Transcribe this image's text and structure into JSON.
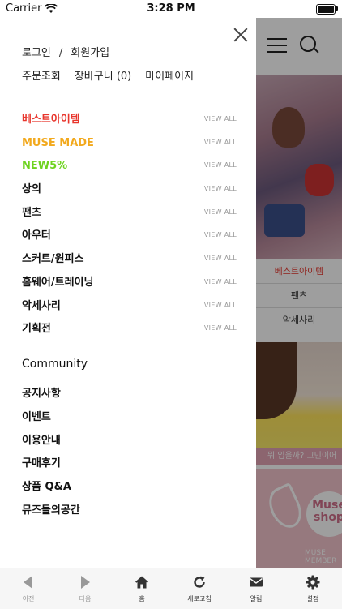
{
  "status_bar": {
    "carrier": "Carrier",
    "time": "3:28 PM"
  },
  "drawer": {
    "account": {
      "login": "로그인",
      "separator": "/",
      "signup": "회원가입"
    },
    "quick_links": {
      "orders": "주문조회",
      "cart": "장바구니 (0)",
      "mypage": "마이페이지"
    },
    "categories": [
      {
        "label": "베스트아이템",
        "color": "#e8352c",
        "view_all": "VIEW ALL"
      },
      {
        "label": "MUSE MADE",
        "color": "#f2a91d",
        "view_all": "VIEW ALL"
      },
      {
        "label": "NEW5%",
        "color": "#6ed31f",
        "view_all": "VIEW ALL"
      },
      {
        "label": "상의",
        "color": "#111111",
        "view_all": "VIEW ALL"
      },
      {
        "label": "팬츠",
        "color": "#111111",
        "view_all": "VIEW ALL"
      },
      {
        "label": "아우터",
        "color": "#111111",
        "view_all": "VIEW ALL"
      },
      {
        "label": "스커트/원피스",
        "color": "#111111",
        "view_all": "VIEW ALL"
      },
      {
        "label": "홈웨어/트레이닝",
        "color": "#111111",
        "view_all": "VIEW ALL"
      },
      {
        "label": "악세사리",
        "color": "#111111",
        "view_all": "VIEW ALL"
      },
      {
        "label": "기획전",
        "color": "#111111",
        "view_all": "VIEW ALL"
      }
    ],
    "community": {
      "title": "Community",
      "items": [
        "공지사항",
        "이벤트",
        "이용안내",
        "구매후기",
        "상품 Q&A",
        "뮤즈들의공간"
      ]
    }
  },
  "background_page": {
    "categories": [
      "베스트아이템",
      "팬츠",
      "악세사리"
    ],
    "active_category_color": "#e8352c",
    "promo_text": "뭐 입을까? 고민이어",
    "logo_text": "Muse shop",
    "caption": "MUSE MEMBER"
  },
  "bottom_bar": {
    "tabs": [
      {
        "label": "이전",
        "icon": "back-icon",
        "disabled": true
      },
      {
        "label": "다음",
        "icon": "forward-icon",
        "disabled": true
      },
      {
        "label": "홈",
        "icon": "home-icon",
        "disabled": false
      },
      {
        "label": "새로고침",
        "icon": "refresh-icon",
        "disabled": false
      },
      {
        "label": "알림",
        "icon": "mail-icon",
        "disabled": false
      },
      {
        "label": "설정",
        "icon": "gear-icon",
        "disabled": false
      }
    ]
  }
}
